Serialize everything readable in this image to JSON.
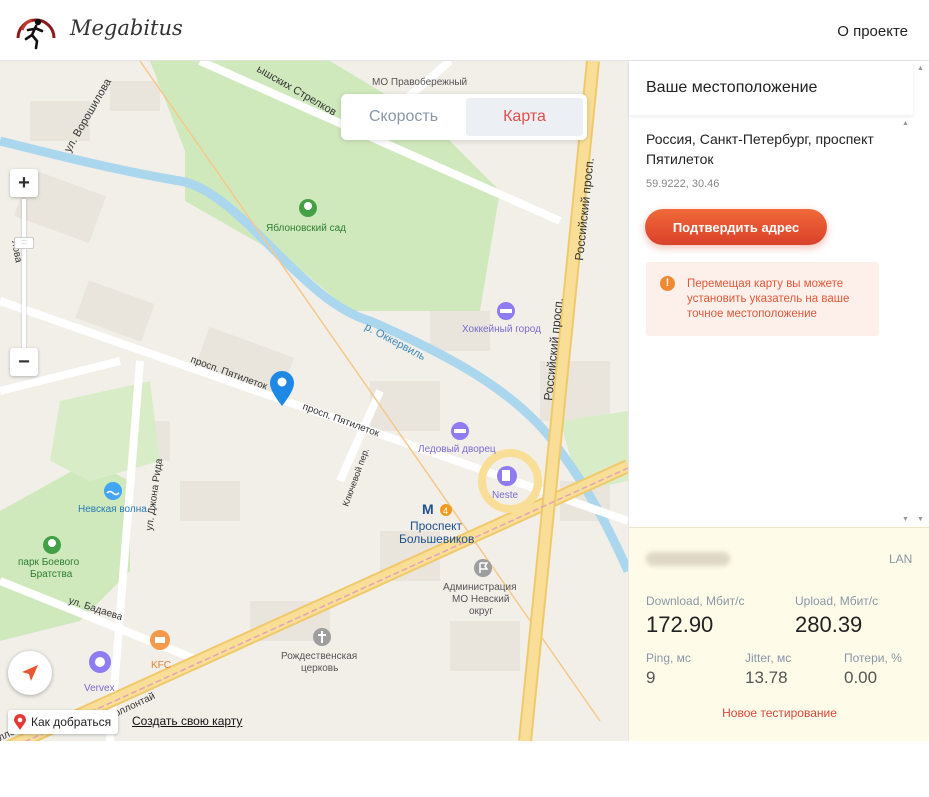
{
  "header": {
    "brand": "Megabitus",
    "nav_about": "О проекте"
  },
  "tabs": {
    "speed": "Скорость",
    "map": "Карта",
    "active": "map"
  },
  "map": {
    "labels": {
      "street_strelkov": "ышских Стрелков",
      "mo_pravoberezhny": "МО Правобережный",
      "street_voroshilova": "ул. Ворошилова",
      "park_yablonovsky": "Яблоновский сад",
      "river_okkervil": "р. Оккервиль",
      "hockey_city": "Хоккейный город",
      "russian_prosp_1": "Российский просп.",
      "russian_prosp_2": "Российский просп.",
      "prosp_pyatiletok_1": "просп. Пятилеток",
      "prosp_pyatiletok_2": "просп. Пятилеток",
      "ice_palace": "Ледовый дворец",
      "neste": "Neste",
      "john_reed": "ул. Джона Рида",
      "klyuchevoy": "Ключевой пер.",
      "nevskaya_volna": "Невская волна",
      "metro_name_1": "Проспект",
      "metro_name_2": "Большевиков",
      "metro_line": "4",
      "admin_1": "Администрация",
      "admin_2": "МО Невский",
      "admin_3": "округ",
      "park_boevogo_1": "парк Боевого",
      "park_boevogo_2": "Братства",
      "badaeva": "ул. Бадаева",
      "church_1": "Рождественская",
      "church_2": "церковь",
      "kfc": "KFC",
      "vervex": "Vervex",
      "kollontai": "ул. Коллонтай",
      "left_edge_1": "лова",
      "left_edge_2": "ллонта"
    },
    "route_button": "Как добраться",
    "create_map_link": "Создать свою карту"
  },
  "panel": {
    "title": "Ваше местоположение",
    "address": "Россия, Санкт-Петербург, проспект Пятилеток",
    "coords": "59.9222, 30.46",
    "confirm_button": "Подтвердить адрес",
    "hint": "Перемещая карту вы можете установить указатель на ваше точное местоположение"
  },
  "results": {
    "connection": "LAN",
    "download_label": "Download, Мбит/с",
    "download_value": "172.90",
    "upload_label": "Upload, Мбит/с",
    "upload_value": "280.39",
    "ping_label": "Ping, мс",
    "ping_value": "9",
    "jitter_label": "Jitter, мс",
    "jitter_value": "13.78",
    "loss_label": "Потери, %",
    "loss_value": "0.00",
    "retest_button": "Новое тестирование"
  },
  "colors": {
    "accent": "#e0504b",
    "button_gradient_top": "#f0693a",
    "button_gradient_bottom": "#d9412a",
    "results_bg": "#fefbe9",
    "map_pin": "#1e88e5",
    "park_green": "#c8e6b0",
    "river_blue": "#aad6ee",
    "highway_yellow": "#f5d98a"
  }
}
